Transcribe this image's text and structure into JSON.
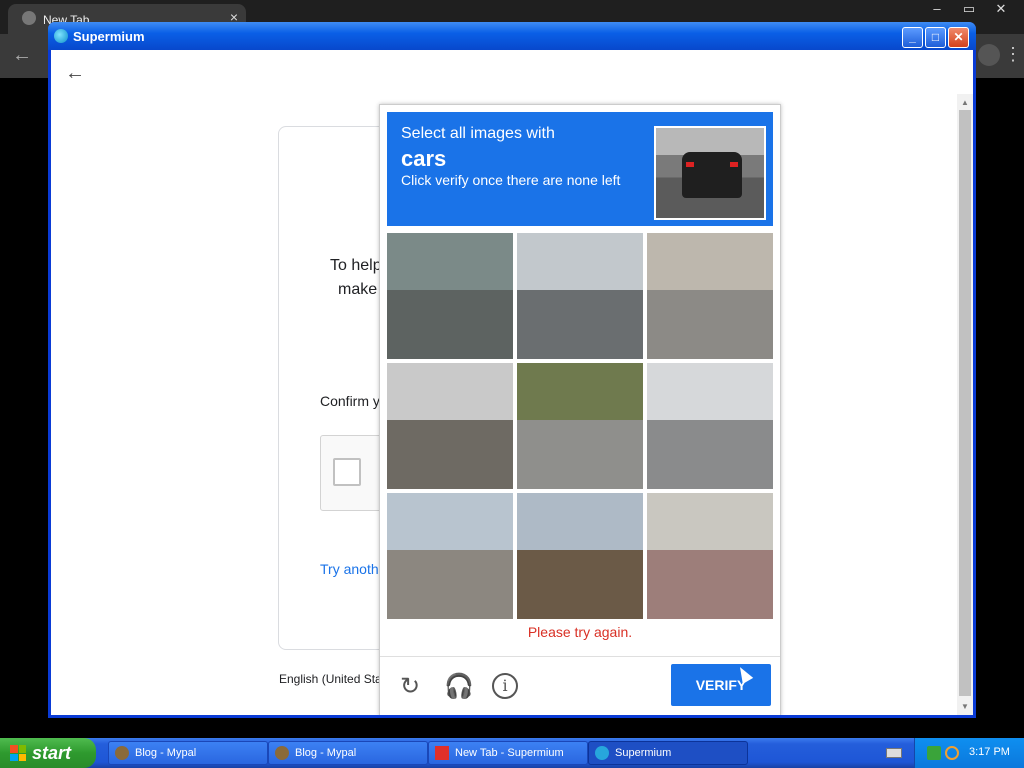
{
  "background_browser": {
    "tab_title": "New Tab",
    "tab_close": "×",
    "window_controls": [
      "–",
      "▭",
      "✕"
    ],
    "back_glyph": "←",
    "kebab_glyph": "⋮"
  },
  "window": {
    "title": "Supermium",
    "controls": {
      "minimize": "_",
      "maximize": "□",
      "close": "✕"
    }
  },
  "page": {
    "back_glyph": "←",
    "text_line1": "To help",
    "text_line2": "make",
    "confirm_label": "Confirm y",
    "try_another_link": "Try anoth",
    "language": "English (United Sta"
  },
  "captcha": {
    "header_select": "Select all images with",
    "header_object": "cars",
    "header_instruction": "Click verify once there are none left",
    "tiles": [
      {
        "name": "tile-1",
        "sky": "#7b8a88",
        "ground": "#5d6361"
      },
      {
        "name": "tile-2",
        "sky": "#c2c8cc",
        "ground": "#6a6e70"
      },
      {
        "name": "tile-3",
        "sky": "#bdb7ad",
        "ground": "#8c8a86"
      },
      {
        "name": "tile-4",
        "sky": "#c9c9c9",
        "ground": "#6e6a63"
      },
      {
        "name": "tile-5",
        "sky": "#6f7a4e",
        "ground": "#8f8f8c"
      },
      {
        "name": "tile-6",
        "sky": "#d6d8da",
        "ground": "#8a8b8c"
      },
      {
        "name": "tile-7",
        "sky": "#b8c4cf",
        "ground": "#8c8780"
      },
      {
        "name": "tile-8",
        "sky": "#aebac6",
        "ground": "#6b5a47"
      },
      {
        "name": "tile-9",
        "sky": "#c9c7c0",
        "ground": "#9d7e7a"
      }
    ],
    "error_message": "Please try again.",
    "reload_glyph": "↻",
    "audio_glyph": "🎧",
    "info_glyph": "i",
    "verify_label": "VERIFY"
  },
  "taskbar": {
    "start_label": "start",
    "tasks": [
      {
        "label": "Blog - Mypal"
      },
      {
        "label": "Blog - Mypal"
      },
      {
        "label": "New Tab - Supermium"
      },
      {
        "label": "Supermium"
      }
    ],
    "clock": "3:17 PM"
  },
  "colors": {
    "captcha_accent": "#1a73e8",
    "error": "#d93025",
    "xp_blue": "#0a3bd6",
    "start_green": "#2e9a2e"
  }
}
